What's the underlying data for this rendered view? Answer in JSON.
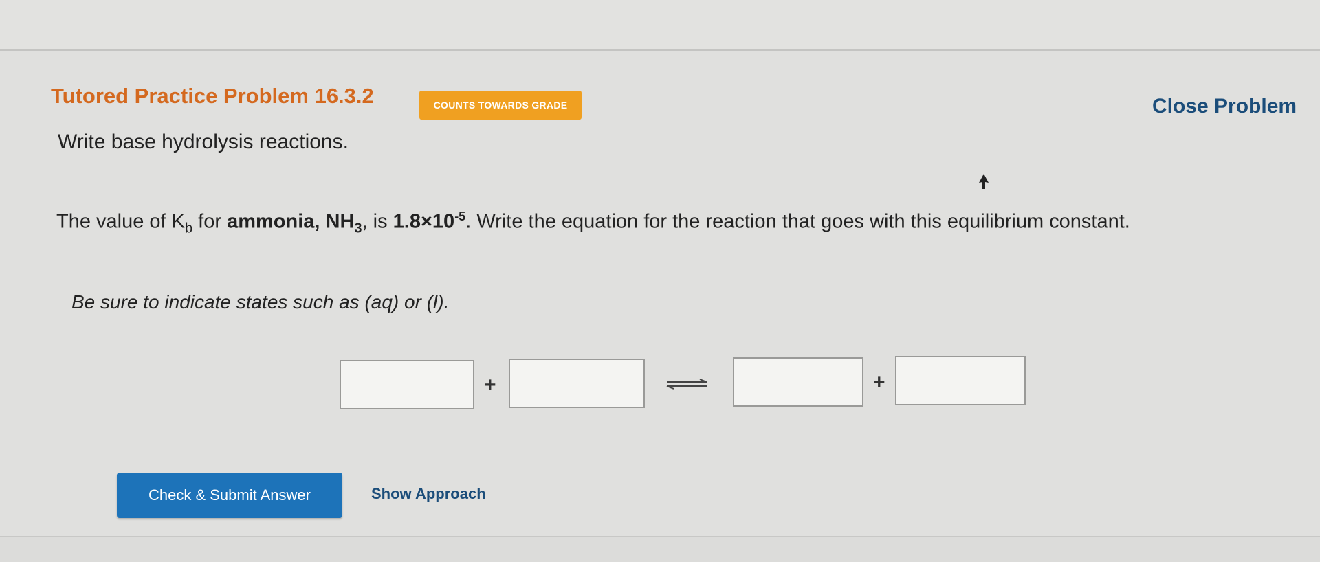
{
  "header": {
    "title": "Tutored Practice Problem 16.3.2",
    "badge": "COUNTS TOWARDS GRADE",
    "close_label": "Close Problem"
  },
  "subtitle": "Write base hydrolysis reactions.",
  "question": {
    "part1": "The value of K",
    "kb_sub": "b",
    "part2": " for ",
    "substance": "ammonia, NH",
    "nh3_sub": "3",
    "part3": ", is ",
    "value_base": "1.8×10",
    "value_exp": "-5",
    "part4": ". Write the equation for the reaction that goes with this equilibrium constant."
  },
  "hint": "Be sure to indicate states such as (aq) or (l).",
  "equation": {
    "reactant1": "",
    "plus1": "+",
    "reactant2": "",
    "arrow_icon": "equilibrium-arrow-icon",
    "product1": "",
    "plus2": "+",
    "product2": ""
  },
  "actions": {
    "submit_label": "Check & Submit Answer",
    "approach_label": "Show Approach"
  },
  "colors": {
    "title": "#d4691f",
    "badge": "#f0a021",
    "link": "#1b4d7a",
    "button": "#1d73b9"
  }
}
